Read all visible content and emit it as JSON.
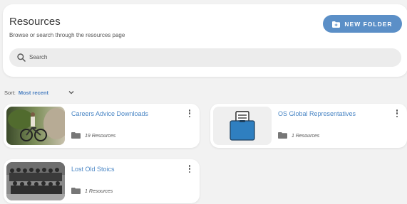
{
  "header": {
    "title": "Resources",
    "subtitle": "Browse or search through the resources page",
    "new_folder_label": "NEW FOLDER",
    "accent_color": "#5b8fc7"
  },
  "search": {
    "placeholder": "Search",
    "value": ""
  },
  "sort": {
    "label": "Sort:",
    "value": "Most recent"
  },
  "folders": [
    {
      "title": "Careers Advice Downloads",
      "count_label": "19 Resources",
      "thumbnail": "photo-bicycle"
    },
    {
      "title": "OS Global Representatives",
      "count_label": "1 Resources",
      "thumbnail": "folder-document-icon"
    },
    {
      "title": "Lost Old Stoics",
      "count_label": "1 Resources",
      "thumbnail": "photo-group-bw"
    }
  ]
}
